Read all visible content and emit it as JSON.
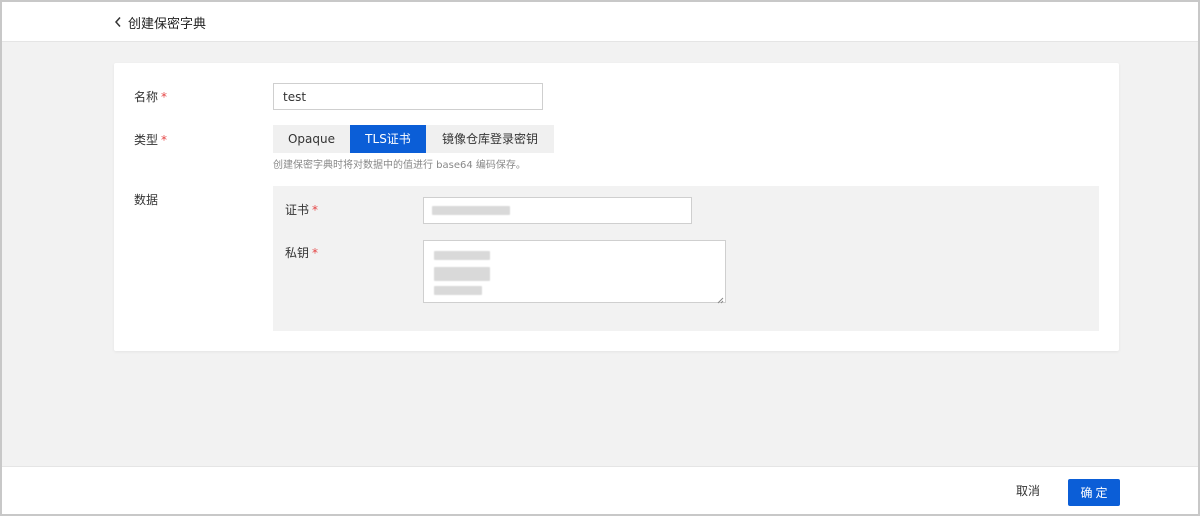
{
  "header": {
    "back_icon": "chevron-left-icon",
    "title": "创建保密字典"
  },
  "form": {
    "name": {
      "label": "名称",
      "required_mark": "*",
      "value": "test"
    },
    "type": {
      "label": "类型",
      "required_mark": "*",
      "options": [
        "Opaque",
        "TLS证书",
        "镜像仓库登录密钥"
      ],
      "selected": "TLS证书",
      "hint": "创建保密字典时将对数据中的值进行 base64 编码保存。"
    },
    "data": {
      "label": "数据",
      "certificate": {
        "label": "证书",
        "required_mark": "*"
      },
      "private_key": {
        "label": "私钥",
        "required_mark": "*"
      }
    }
  },
  "footer": {
    "cancel_label": "取消",
    "confirm_label": "确定"
  },
  "colors": {
    "primary": "#0b5ed7",
    "required": "#e54545",
    "page_background": "#f2f2f2"
  }
}
